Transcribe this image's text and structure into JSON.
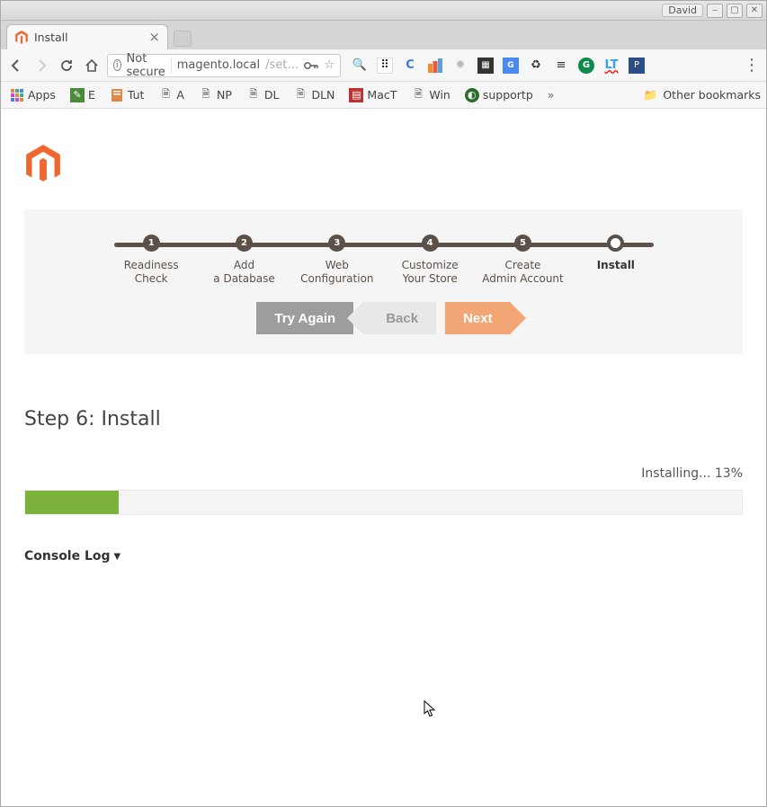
{
  "os": {
    "user": "David"
  },
  "browser": {
    "tab_title": "Install",
    "url_security": "Not secure",
    "url_host": "magento.local",
    "url_path": "/set…",
    "other_bookmarks": "Other bookmarks",
    "bookmarks": [
      {
        "label": "Apps"
      },
      {
        "label": "E"
      },
      {
        "label": "Tut"
      },
      {
        "label": "A"
      },
      {
        "label": "NP"
      },
      {
        "label": "DL"
      },
      {
        "label": "DLN"
      },
      {
        "label": "MacT"
      },
      {
        "label": "Win"
      },
      {
        "label": "supportp"
      }
    ]
  },
  "wizard": {
    "steps": [
      {
        "num": "1",
        "label": "Readiness\nCheck"
      },
      {
        "num": "2",
        "label": "Add\na Database"
      },
      {
        "num": "3",
        "label": "Web\nConfiguration"
      },
      {
        "num": "4",
        "label": "Customize\nYour Store"
      },
      {
        "num": "5",
        "label": "Create\nAdmin Account"
      },
      {
        "num": "",
        "label": "Install"
      }
    ],
    "try_again": "Try Again",
    "back": "Back",
    "next": "Next"
  },
  "install": {
    "heading": "Step 6: Install",
    "status": "Installing... 13%",
    "progress_percent": 13,
    "console_log": "Console Log"
  },
  "colors": {
    "accent": "#ef672f",
    "progress": "#7cb13b"
  }
}
